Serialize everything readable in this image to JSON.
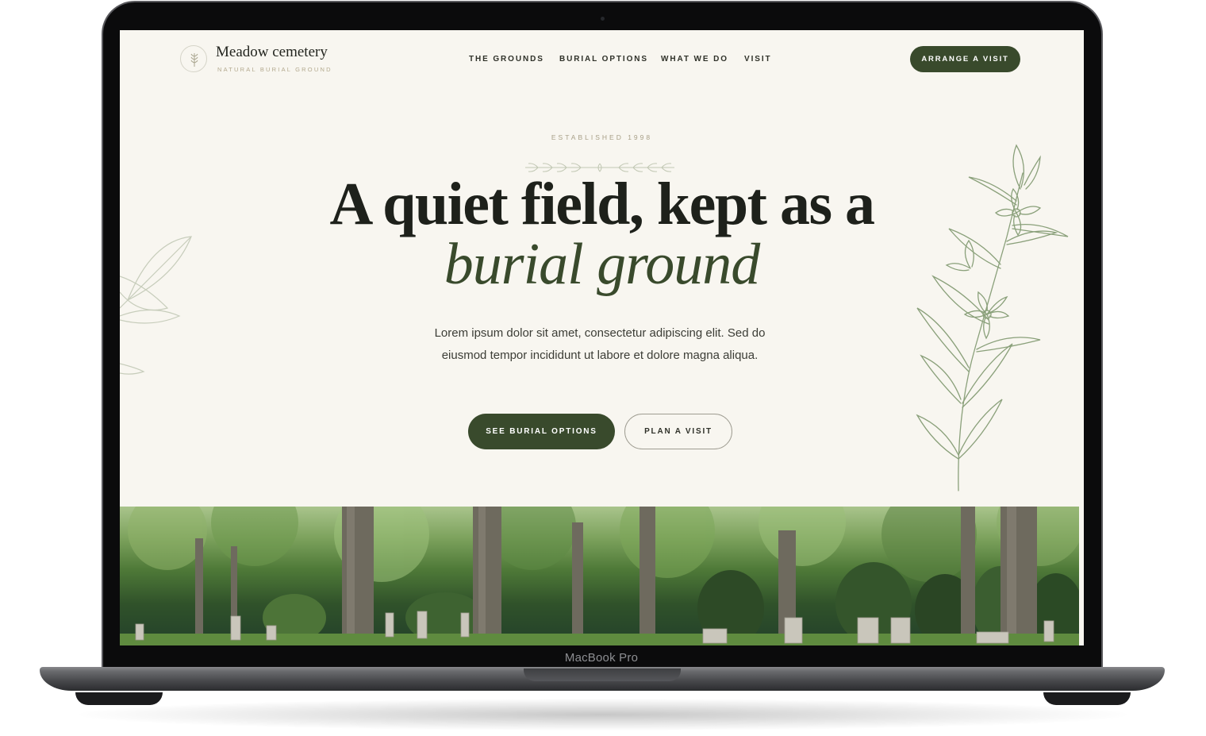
{
  "device": {
    "label": "MacBook Pro"
  },
  "brand": {
    "name": "Meadow cemetery",
    "tagline": "NATURAL BURIAL GROUND"
  },
  "nav": {
    "links": [
      "THE GROUNDS",
      "BURIAL OPTIONS",
      "WHAT WE DO",
      "VISIT"
    ],
    "cta": "ARRANGE A VISIT"
  },
  "hero": {
    "eyebrow": "ESTABLISHED 1998",
    "headline": "A quiet field, kept as a",
    "headline_accent": "burial ground",
    "body": "Lorem ipsum dolor sit amet, consectetur adipiscing elit. Sed do eiusmod tempor incididunt ut labore et dolore magna aliqua.",
    "primary_button": "SEE BURIAL OPTIONS",
    "secondary_button": "PLAN A VISIT"
  },
  "colors": {
    "brand_green": "#394a2c",
    "page_background": "#f8f6f0",
    "botanical_line": "#8aa07a"
  },
  "icons": [
    "wheat-sprig-icon",
    "laurel-divider-icon",
    "flower-illustration",
    "leaf-illustration"
  ]
}
